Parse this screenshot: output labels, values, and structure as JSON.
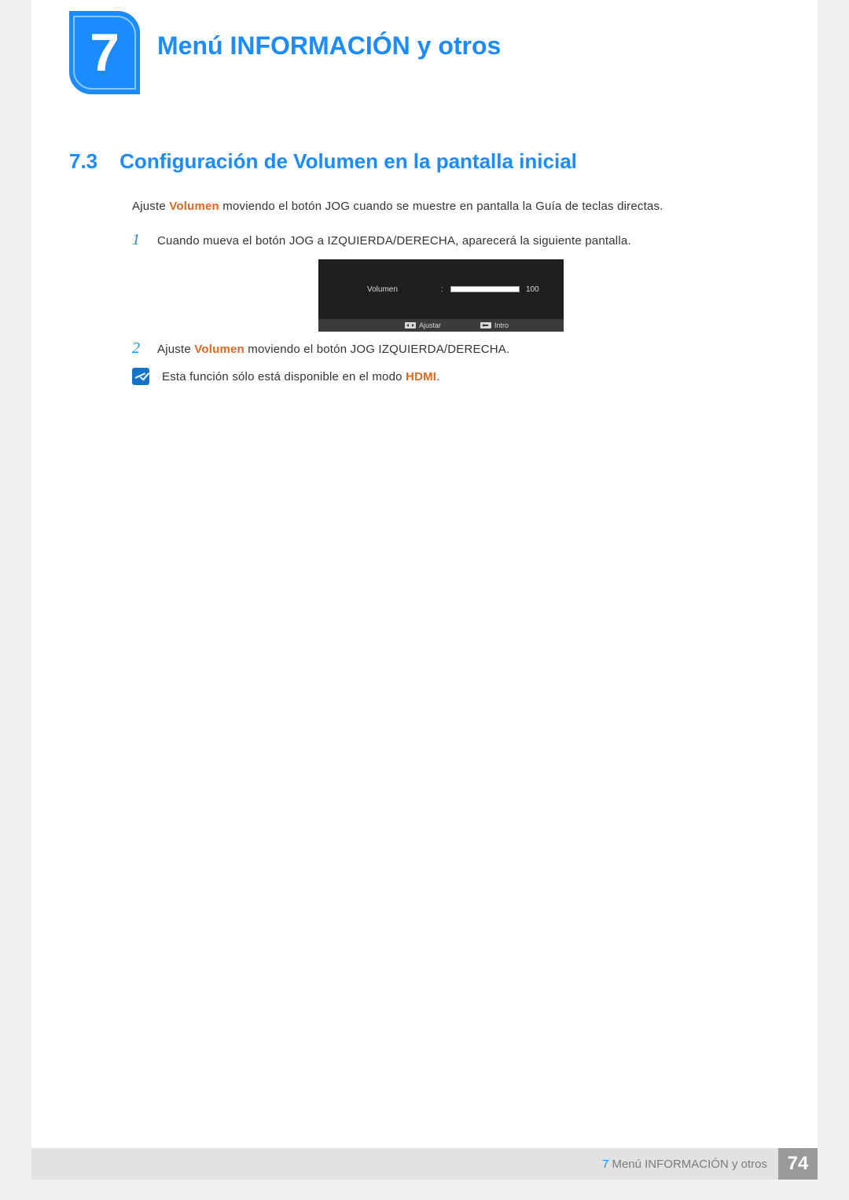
{
  "chapter": {
    "number": "7",
    "title": "Menú INFORMACIÓN y otros"
  },
  "section": {
    "number": "7.3",
    "title": "Configuración de Volumen en la pantalla inicial"
  },
  "intro": {
    "pre": "Ajuste ",
    "highlight": "Volumen",
    "post": " moviendo el botón JOG cuando se muestre en pantalla la Guía de teclas directas."
  },
  "step1": {
    "num": "1",
    "text": "Cuando mueva el botón JOG a IZQUIERDA/DERECHA, aparecerá la siguiente pantalla."
  },
  "osd": {
    "label": "Volumen",
    "colon": ":",
    "value": "100",
    "adjust_label": "Ajustar",
    "enter_label": "Intro"
  },
  "step2": {
    "num": "2",
    "pre": "Ajuste ",
    "highlight": "Volumen",
    "post": " moviendo el botón JOG IZQUIERDA/DERECHA."
  },
  "note": {
    "pre": "Esta función sólo está disponible en el modo ",
    "highlight": "HDMI",
    "post": "."
  },
  "footer": {
    "chapter_num": "7",
    "chapter_title": "Menú INFORMACIÓN y otros",
    "page": "74"
  }
}
